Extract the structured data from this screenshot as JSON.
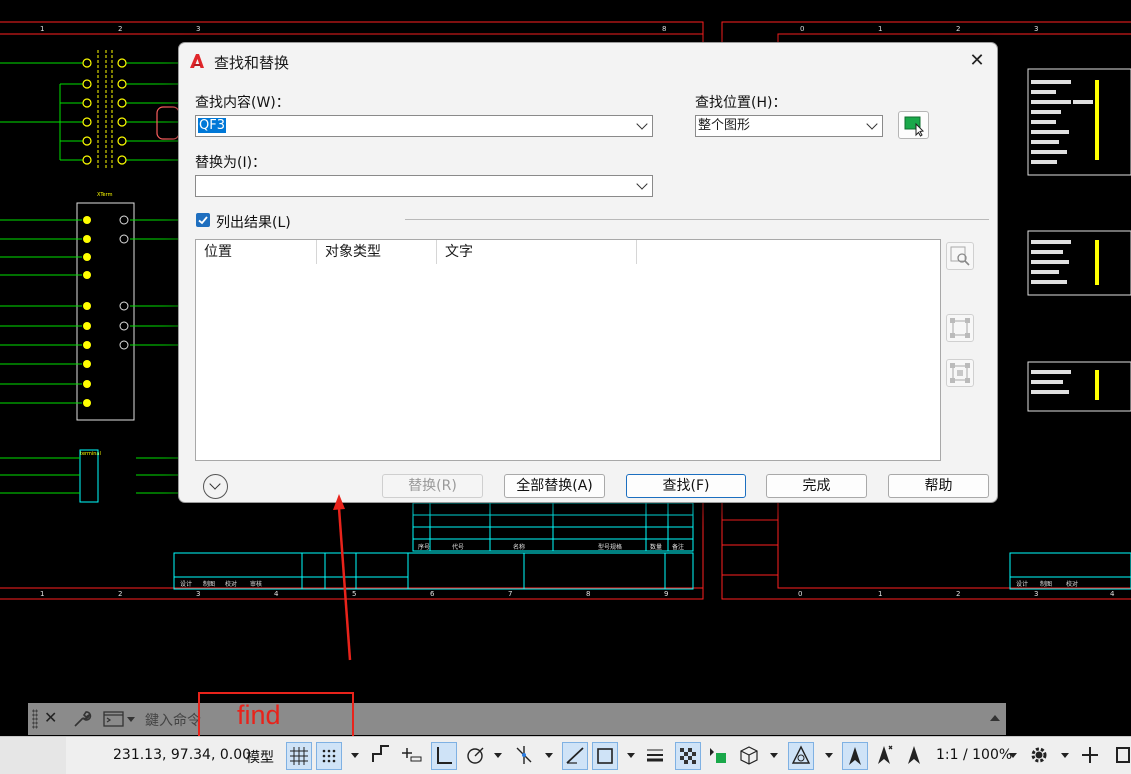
{
  "dialog": {
    "title": "查找和替换",
    "find_label": "查找内容(W)：",
    "find_value": "QF3",
    "replace_label": "替换为(I)：",
    "replace_value": "",
    "find_where_label": "查找位置(H)：",
    "find_where_value": "整个图形",
    "list_results_label": "列出结果(L)",
    "list_results_checked": true,
    "columns": [
      "位置",
      "对象类型",
      "文字"
    ],
    "buttons": {
      "replace": "替换(R)",
      "replace_all": "全部替换(A)",
      "find": "查找(F)",
      "done": "完成",
      "help": "帮助"
    },
    "close_symbol": "✕"
  },
  "annotation": {
    "text": "find",
    "color": "#e8231b"
  },
  "command_line": {
    "placeholder": "鍵入命令"
  },
  "status_bar": {
    "coordinates": "231.13, 97.34, 0.00",
    "model_tab": "模型",
    "scale": "1:1 / 100%"
  },
  "colors": {
    "accent": "#1f6fbf",
    "cad_red": "#ff1a1a",
    "cad_green": "#00e000",
    "cad_yellow": "#ffff00",
    "cad_cyan": "#00ffff"
  }
}
